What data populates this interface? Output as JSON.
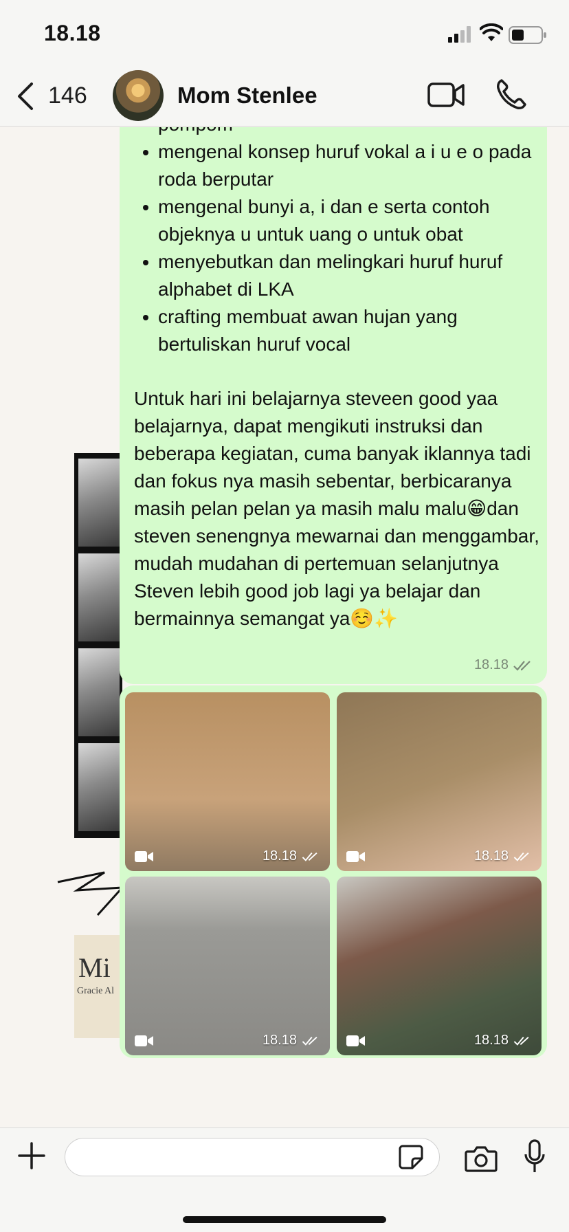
{
  "status_bar": {
    "time": "18.18"
  },
  "header": {
    "back_count": "146",
    "contact_name": "Mom Stenlee"
  },
  "message": {
    "bullets": [
      "mengenal konsep huruf vokal a i u e o pada roda berputar",
      "mengenal bunyi a, i dan e serta contoh objeknya u untuk uang o untuk obat",
      "menyebutkan dan melingkari huruf huruf alphabet di LKA",
      "crafting membuat awan hujan yang bertuliskan huruf vocal"
    ],
    "lead_fragment": "pompom",
    "paragraph": "Untuk hari ini belajarnya steveen good yaa belajarnya, dapat mengikuti instruksi dan beberapa kegiatan, cuma banyak iklannya tadi dan fokus nya masih sebentar, berbicaranya masih pelan pelan ya masih malu malu😁dan steven senengnya mewarnai dan menggambar, mudah mudahan di pertemuan selanjutnya Steven lebih good job lagi ya belajar dan bermainnya semangat ya☺️✨",
    "time": "18.18"
  },
  "media": [
    {
      "type": "video",
      "time": "18.18"
    },
    {
      "type": "video",
      "time": "18.18"
    },
    {
      "type": "video",
      "time": "18.18"
    },
    {
      "type": "video",
      "time": "18.18"
    }
  ],
  "wallpaper": {
    "clipping_big": "Mi",
    "clipping_name": "Gracie Al"
  },
  "input": {
    "placeholder": ""
  },
  "colors": {
    "bubble": "#d5fbcc",
    "bar": "#f6f6f4"
  }
}
